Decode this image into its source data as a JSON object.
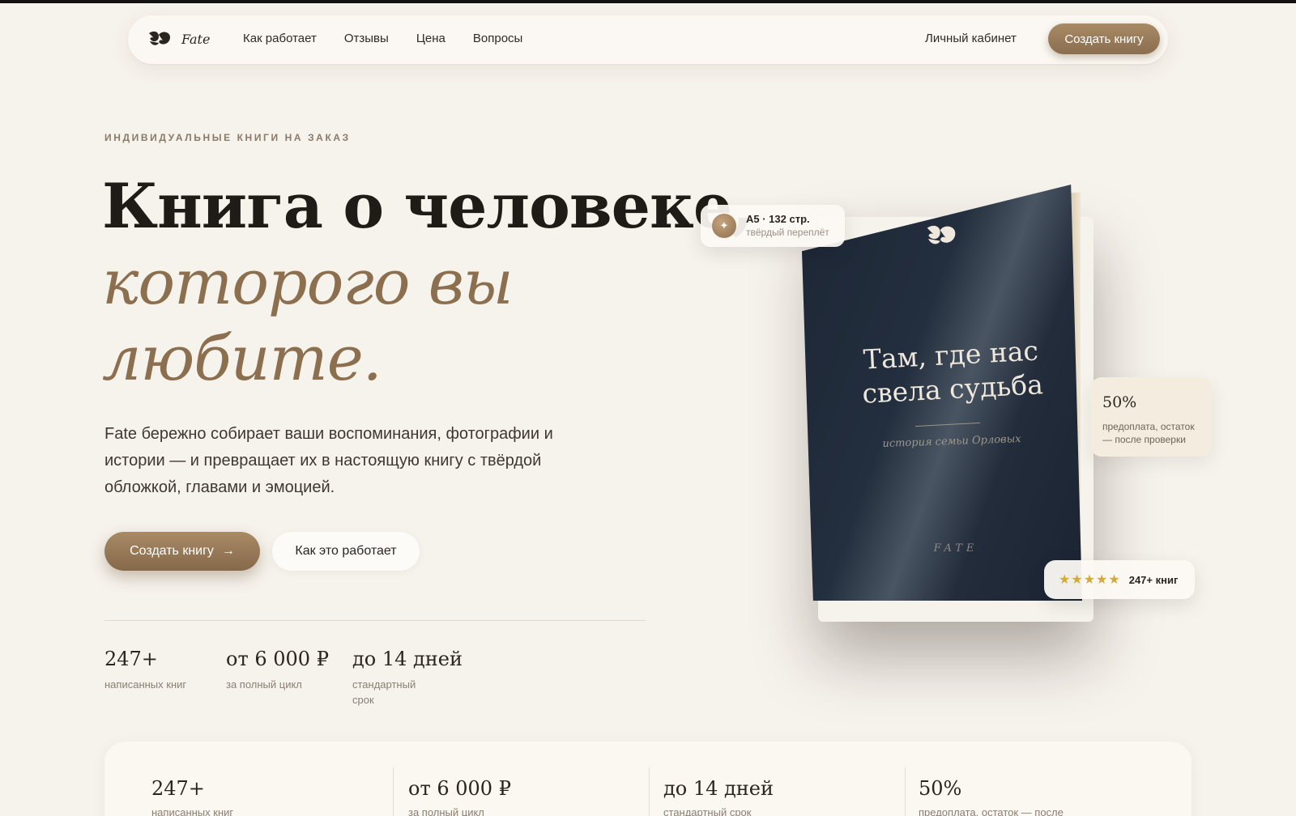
{
  "nav": {
    "brand": "Fate",
    "links": [
      "Как работает",
      "Отзывы",
      "Цена",
      "Вопросы"
    ],
    "account": "Личный кабинет",
    "cta": "Создать книгу"
  },
  "hero": {
    "eyebrow": "ИНДИВИДУАЛЬНЫЕ КНИГИ НА ЗАКАЗ",
    "title_line1": "Книга о человеке,",
    "title_accent": "которого вы любите.",
    "lead": "Fate бережно собирает ваши воспоминания, фотографии и истории — и превращает их в настоящую книгу с твёрдой обложкой, главами и эмоцией.",
    "primary_button": "Создать книгу",
    "primary_arrow": "→",
    "secondary_button": "Как это работает",
    "stats": [
      {
        "value": "247+",
        "label": "написанных книг"
      },
      {
        "value": "от 6 000 ₽",
        "label": "за полный цикл"
      },
      {
        "value": "до 14 дней",
        "label": "стандартный срок"
      }
    ]
  },
  "book": {
    "title": "Там, где нас свела судьба",
    "subtitle": "история семьи Орловых",
    "brand": "FATE"
  },
  "cards": {
    "format_icon": "✦",
    "format_title": "А5 · 132 стр.",
    "format_sub": "твёрдый переплёт",
    "prepay_value": "50%",
    "prepay_label": "предоплата, остаток — после проверки",
    "rating_stars": "★★★★★",
    "rating_stars_value": 5,
    "rating_text": "247+ книг"
  },
  "strip": [
    {
      "value": "247+",
      "label": "написанных книг"
    },
    {
      "value": "от 6 000 ₽",
      "label": "за полный цикл"
    },
    {
      "value": "до 14 дней",
      "label": "стандартный срок"
    },
    {
      "value": "50%",
      "label": "предоплата, остаток — после"
    }
  ],
  "colors": {
    "accent": "#8b6f4e",
    "background": "#f6f2ec",
    "book_cover": "#1f2938",
    "star": "#d4a93c"
  }
}
